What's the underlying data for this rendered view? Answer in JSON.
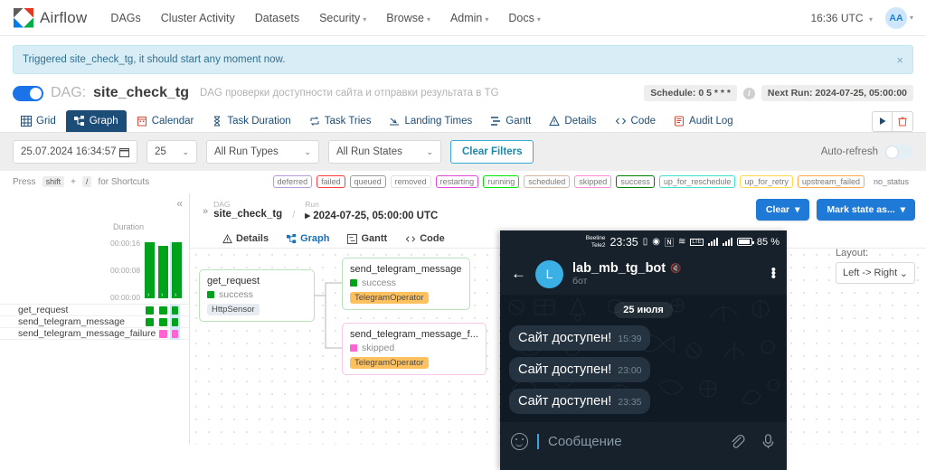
{
  "navbar": {
    "brand": "Airflow",
    "links": [
      {
        "label": "DAGs",
        "caret": false
      },
      {
        "label": "Cluster Activity",
        "caret": false
      },
      {
        "label": "Datasets",
        "caret": false
      },
      {
        "label": "Security",
        "caret": true
      },
      {
        "label": "Browse",
        "caret": true
      },
      {
        "label": "Admin",
        "caret": true
      },
      {
        "label": "Docs",
        "caret": true
      }
    ],
    "clock": "16:36 UTC",
    "avatar": "AA"
  },
  "alert": {
    "message": "Triggered site_check_tg, it should start any moment now.",
    "close": "×"
  },
  "dag_header": {
    "prefix": "DAG:",
    "name": "site_check_tg",
    "description": "DAG проверки доступности сайта и отправки результата в TG",
    "schedule": "Schedule: 0 5 * * *",
    "next_run": "Next Run: 2024-07-25, 05:00:00"
  },
  "tabs": [
    {
      "label": "Grid",
      "icon": "grid-icon",
      "active": false
    },
    {
      "label": "Graph",
      "icon": "graph-icon",
      "active": true
    },
    {
      "label": "Calendar",
      "icon": "calendar-icon",
      "active": false
    },
    {
      "label": "Task Duration",
      "icon": "hourglass-icon",
      "active": false
    },
    {
      "label": "Task Tries",
      "icon": "retry-icon",
      "active": false
    },
    {
      "label": "Landing Times",
      "icon": "landing-icon",
      "active": false
    },
    {
      "label": "Gantt",
      "icon": "gantt-icon",
      "active": false
    },
    {
      "label": "Details",
      "icon": "details-icon",
      "active": false
    },
    {
      "label": "Code",
      "icon": "code-icon",
      "active": false
    },
    {
      "label": "Audit Log",
      "icon": "audit-icon",
      "active": false
    }
  ],
  "filters": {
    "date_value": "25.07.2024 16:34:57",
    "count_value": "25",
    "run_types": "All Run Types",
    "run_states": "All Run States",
    "clear_label": "Clear Filters",
    "autorefresh_label": "Auto-refresh"
  },
  "shortcut": {
    "press": "Press",
    "key1": "shift",
    "plus": "+",
    "key2": "/",
    "suffix": "for Shortcuts"
  },
  "legend": [
    {
      "label": "deferred",
      "color": "#b39ddb"
    },
    {
      "label": "failed",
      "color": "#ff3d3d"
    },
    {
      "label": "queued",
      "color": "#9e9e9e"
    },
    {
      "label": "removed",
      "color": "#e0e0e0"
    },
    {
      "label": "restarting",
      "color": "#e24bd8"
    },
    {
      "label": "running",
      "color": "#00e800"
    },
    {
      "label": "scheduled",
      "color": "#d3b8a4"
    },
    {
      "label": "skipped",
      "color": "#ff8ad8"
    },
    {
      "label": "success",
      "color": "#008000"
    },
    {
      "label": "up_for_reschedule",
      "color": "#40e0d0"
    },
    {
      "label": "up_for_retry",
      "color": "#ffd84d"
    },
    {
      "label": "upstream_failed",
      "color": "#ffa84d"
    },
    {
      "label": "no_status",
      "color": "transparent"
    }
  ],
  "grid_panel": {
    "collapse_icon": "«",
    "chart_title": "Duration",
    "y_labels": [
      "00:00:16",
      "00:00:08",
      "00:00:00"
    ],
    "tasks": [
      {
        "name": "get_request",
        "states": [
          "success",
          "success",
          "success"
        ]
      },
      {
        "name": "send_telegram_message",
        "states": [
          "success",
          "success",
          "success"
        ]
      },
      {
        "name": "send_telegram_message_failure",
        "states": [
          "none",
          "skipped",
          "skipped"
        ]
      }
    ],
    "bar_heights": [
      62,
      58,
      62
    ],
    "selected_column": 2
  },
  "breadcrumb": {
    "expand_icon": "»",
    "dag_caption": "DAG",
    "dag_value": "site_check_tg",
    "separator": "/",
    "run_caption": "Run",
    "run_value": "▸ 2024-07-25, 05:00:00 UTC"
  },
  "subtabs": [
    {
      "label": "Details",
      "icon": "details-icon",
      "active": false
    },
    {
      "label": "Graph",
      "icon": "graph-icon",
      "active": true
    },
    {
      "label": "Gantt",
      "icon": "gantt-icon",
      "active": false
    },
    {
      "label": "Code",
      "icon": "code-icon",
      "active": false
    }
  ],
  "graph_nodes": [
    {
      "title": "get_request",
      "state": "success",
      "operator": "HttpSensor",
      "operator_kind": "http"
    },
    {
      "title": "send_telegram_message",
      "state": "success",
      "operator": "TelegramOperator",
      "operator_kind": "telegram"
    },
    {
      "title": "send_telegram_message_f...",
      "state": "skipped",
      "operator": "TelegramOperator",
      "operator_kind": "telegram"
    }
  ],
  "graph_controls": {
    "clear": "Clear",
    "mark_state": "Mark state as...",
    "layout_label": "Layout:",
    "layout_value": "Left -> Right"
  },
  "phone": {
    "status": {
      "carrier1": "Beeline",
      "carrier2": "Tele2",
      "time": "23:35",
      "battery_pct": "85 %"
    },
    "chat": {
      "title": "lab_mb_tg_bot",
      "subtitle": "бот",
      "avatar_letter": "L",
      "back_icon": "←",
      "mute_icon": "🔇"
    },
    "date_divider": "25 июля",
    "messages": [
      {
        "text": "Сайт доступен!",
        "time": "15:39"
      },
      {
        "text": "Сайт доступен!",
        "time": "23:00"
      },
      {
        "text": "Сайт доступен!",
        "time": "23:35"
      }
    ],
    "input_placeholder": "Сообщение"
  }
}
